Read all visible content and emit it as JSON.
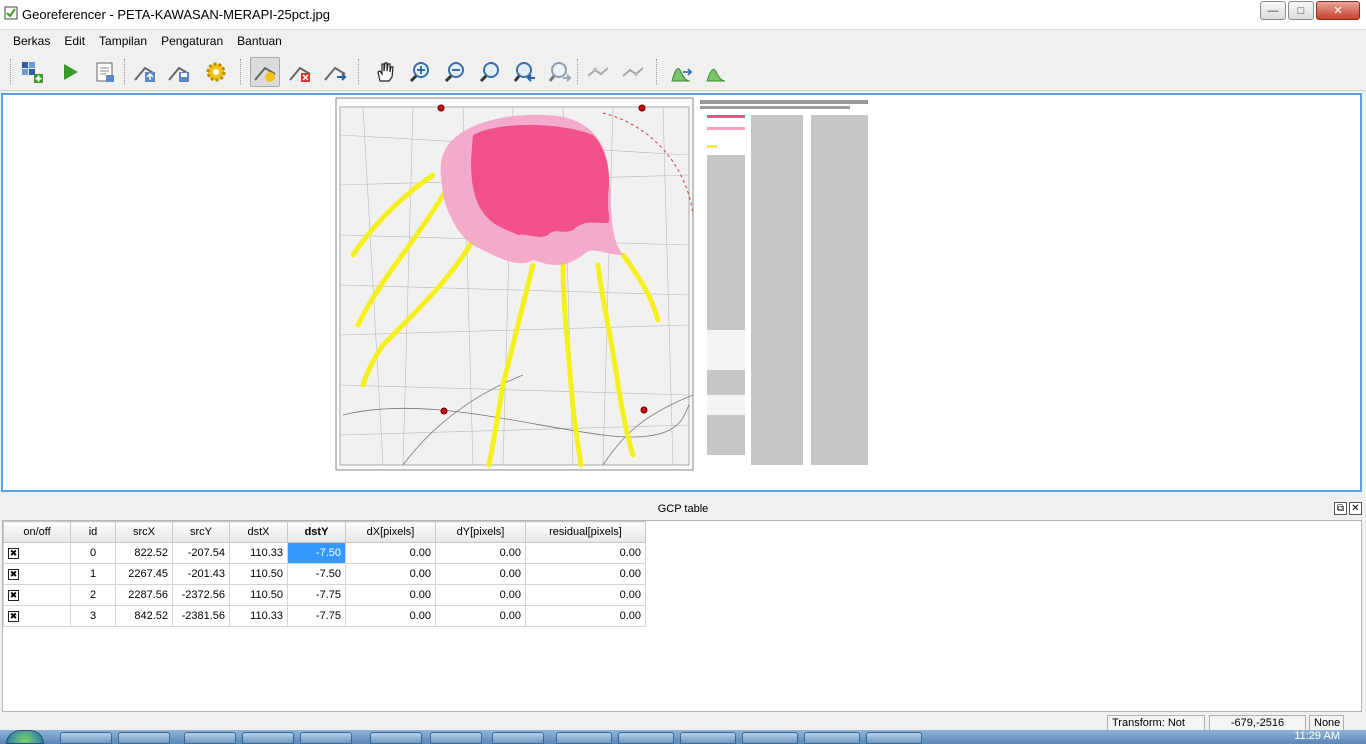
{
  "window": {
    "title": "Georeferencer - PETA-KAWASAN-MERAPI-25pct.jpg"
  },
  "menu": [
    "Berkas",
    "Edit",
    "Tampilan",
    "Pengaturan",
    "Bantuan"
  ],
  "toolbar": {
    "icons": [
      "open-raster-icon",
      "start-georeferencing-icon",
      "generate-gdal-script-icon",
      "load-gcp-points-icon",
      "save-gcp-points-icon",
      "transformation-settings-icon",
      "add-point-icon",
      "delete-point-icon",
      "move-gcp-point-icon",
      "pan-icon",
      "zoom-in-icon",
      "zoom-out-icon",
      "zoom-to-layer-icon",
      "zoom-last-icon",
      "zoom-next-icon",
      "link-georeferencer-to-qgis-icon",
      "link-qgis-to-georeferencer-icon",
      "full-histogram-stretch-icon",
      "local-histogram-stretch-icon"
    ],
    "active": "add-point-icon"
  },
  "gcp_panel": {
    "title": "GCP table",
    "columns": [
      "on/off",
      "id",
      "srcX",
      "srcY",
      "dstX",
      "dstY",
      "dX[pixels]",
      "dY[pixels]",
      "residual[pixels]"
    ],
    "sorted_column": "dstY",
    "rows": [
      {
        "on": true,
        "id": "0",
        "srcX": "822.52",
        "srcY": "-207.54",
        "dstX": "110.33",
        "dstY": "-7.50",
        "dX": "0.00",
        "dY": "0.00",
        "residual": "0.00"
      },
      {
        "on": true,
        "id": "1",
        "srcX": "2267.45",
        "srcY": "-201.43",
        "dstX": "110.50",
        "dstY": "-7.50",
        "dX": "0.00",
        "dY": "0.00",
        "residual": "0.00"
      },
      {
        "on": true,
        "id": "2",
        "srcX": "2287.56",
        "srcY": "-2372.56",
        "dstX": "110.50",
        "dstY": "-7.75",
        "dX": "0.00",
        "dY": "0.00",
        "residual": "0.00"
      },
      {
        "on": true,
        "id": "3",
        "srcX": "842.52",
        "srcY": "-2381.56",
        "dstX": "110.33",
        "dstY": "-7.75",
        "dX": "0.00",
        "dY": "0.00",
        "residual": "0.00"
      }
    ],
    "selected_cell": "dstY of row 0"
  },
  "status": {
    "transform": "Transform: Not set",
    "coords": "-679,-2516",
    "srs": "None"
  },
  "taskbar": {
    "clock": "11:29 AM"
  },
  "colors": {
    "hazard_pink": "#f0508c",
    "hazard_light_pink": "#f4a3c6",
    "lahar_yellow": "#f5ef1e",
    "canvas_border": "#5aa0e6",
    "selection": "#3399ff"
  }
}
